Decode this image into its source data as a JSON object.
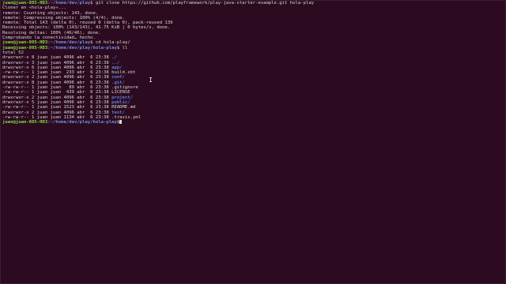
{
  "prompt": {
    "user": "juan@juan-805-HD3",
    "sep": ":",
    "end": "$"
  },
  "block1": {
    "path": "~/home/dev/play",
    "command": " git clone https://github.com/playframework/play-java-starter-example.git hola-play",
    "output": [
      "Cloner en «hola-play»...",
      "remote: Counting objects: 143, done.",
      "remote: Compressing objects: 100% (4/4), done.",
      "remote: Total 143 (delta 0), reused 0 (delta 0), pack-reused 139",
      "Receiving objects: 100% (143/143), 41.75 KiB | 0 bytes/s, done.",
      "Resolving deltas: 100% (46/46), done.",
      "Comprobando la conectividad… hecho."
    ]
  },
  "block2": {
    "path": "~/home/dev/play",
    "command": " cd hola-play/"
  },
  "block3": {
    "path": "~/home/dev/play/hola-play",
    "command": " ll",
    "total": "total 52"
  },
  "listing": [
    {
      "perm": "drwxrwxr-x",
      "links": "8",
      "owner": "juan",
      "group": "juan",
      "size": "4096",
      "month": "abr",
      "day": "6",
      "time": "23:38",
      "name": "./",
      "is_dir": true
    },
    {
      "perm": "drwxrwxr-x",
      "links": "3",
      "owner": "juan",
      "group": "juan",
      "size": "4096",
      "month": "abr",
      "day": "6",
      "time": "23:38",
      "name": "../",
      "is_dir": true
    },
    {
      "perm": "drwxrwxr-x",
      "links": "6",
      "owner": "juan",
      "group": "juan",
      "size": "4096",
      "month": "abr",
      "day": "6",
      "time": "23:38",
      "name": "app/",
      "is_dir": true
    },
    {
      "perm": "-rw-rw-r--",
      "links": "1",
      "owner": "juan",
      "group": "juan",
      "size": "233",
      "month": "abr",
      "day": "6",
      "time": "23:38",
      "name": "build.sbt",
      "is_dir": false
    },
    {
      "perm": "drwxrwxr-x",
      "links": "2",
      "owner": "juan",
      "group": "juan",
      "size": "4096",
      "month": "abr",
      "day": "6",
      "time": "23:38",
      "name": "conf/",
      "is_dir": true
    },
    {
      "perm": "drwxrwxr-x",
      "links": "8",
      "owner": "juan",
      "group": "juan",
      "size": "4096",
      "month": "abr",
      "day": "6",
      "time": "23:38",
      "name": ".git/",
      "is_dir": true
    },
    {
      "perm": "-rw-rw-r--",
      "links": "1",
      "owner": "juan",
      "group": "juan",
      "size": "89",
      "month": "abr",
      "day": "6",
      "time": "23:38",
      "name": ".gitignore",
      "is_dir": false
    },
    {
      "perm": "-rw-rw-r--",
      "links": "1",
      "owner": "juan",
      "group": "juan",
      "size": "439",
      "month": "abr",
      "day": "6",
      "time": "23:38",
      "name": "LICENSE",
      "is_dir": false
    },
    {
      "perm": "drwxrwxr-x",
      "links": "2",
      "owner": "juan",
      "group": "juan",
      "size": "4096",
      "month": "abr",
      "day": "6",
      "time": "23:38",
      "name": "project/",
      "is_dir": true
    },
    {
      "perm": "drwxrwxr-x",
      "links": "5",
      "owner": "juan",
      "group": "juan",
      "size": "4096",
      "month": "abr",
      "day": "6",
      "time": "23:38",
      "name": "public/",
      "is_dir": true
    },
    {
      "perm": "-rw-rw-r--",
      "links": "1",
      "owner": "juan",
      "group": "juan",
      "size": "1523",
      "month": "abr",
      "day": "6",
      "time": "23:38",
      "name": "README.md",
      "is_dir": false
    },
    {
      "perm": "drwxrwxr-x",
      "links": "2",
      "owner": "juan",
      "group": "juan",
      "size": "4096",
      "month": "abr",
      "day": "6",
      "time": "23:38",
      "name": "test/",
      "is_dir": true
    },
    {
      "perm": "-rw-rw-r--",
      "links": "1",
      "owner": "juan",
      "group": "juan",
      "size": "1134",
      "month": "abr",
      "day": "6",
      "time": "23:38",
      "name": ".travis.yml",
      "is_dir": false
    }
  ],
  "block4": {
    "path": "~/home/dev/play/hola-play"
  },
  "colors": {
    "background": "#2c0a1f",
    "text": "#d8d8d8",
    "prompt_user": "#7fe03f",
    "prompt_path": "#6f8fe8",
    "directory": "#5c7fd8"
  },
  "icons": {
    "text_cursor": "ibeam-cursor-icon"
  }
}
